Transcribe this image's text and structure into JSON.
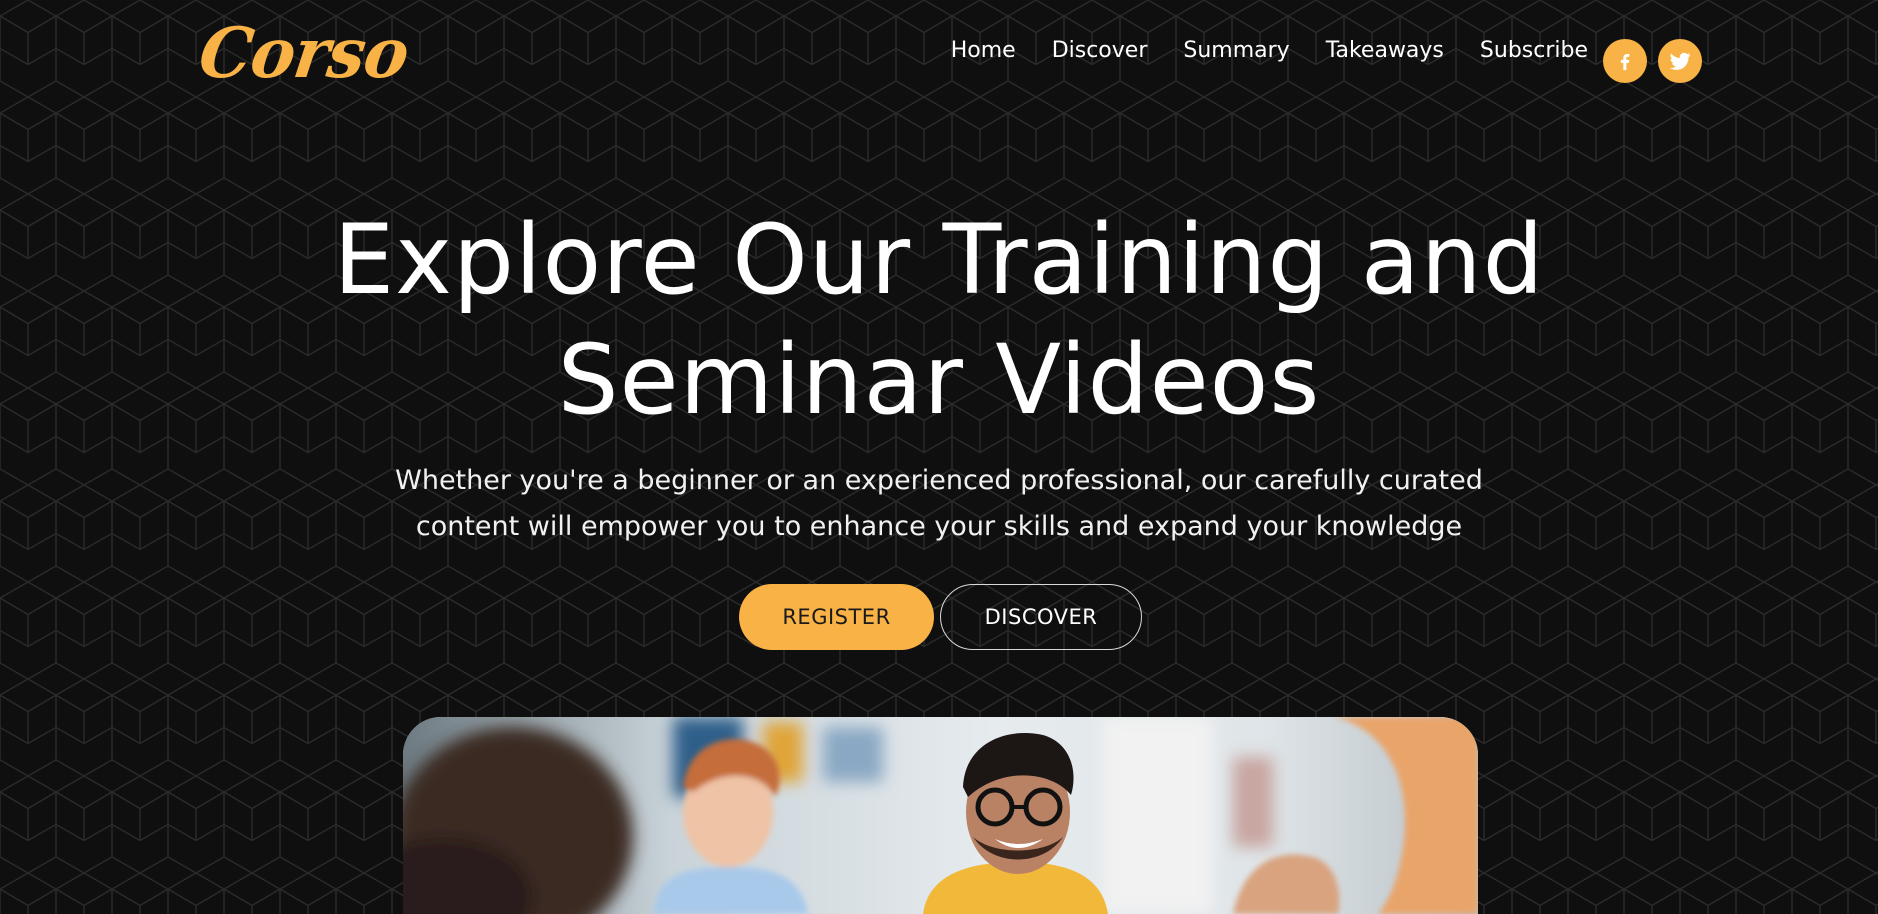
{
  "brand": {
    "logo_text": "Corso",
    "accent_color": "#f8b245",
    "background_color": "#0f0f0f"
  },
  "nav": {
    "items": [
      {
        "label": "Home"
      },
      {
        "label": "Discover"
      },
      {
        "label": "Summary"
      },
      {
        "label": "Takeaways"
      },
      {
        "label": "Subscribe"
      }
    ]
  },
  "social": [
    {
      "icon": "facebook-icon"
    },
    {
      "icon": "twitter-icon"
    }
  ],
  "hero": {
    "title_line1": "Explore Our Training and",
    "title_line2": "Seminar Videos",
    "subtitle_line1": "Whether you're a beginner or an experienced professional, our carefully curated",
    "subtitle_line2": "content will empower you to enhance your skills and expand your knowledge",
    "register_label": "REGISTER",
    "discover_label": "DISCOVER"
  },
  "photo": {
    "subject": "team-meeting-photo"
  }
}
